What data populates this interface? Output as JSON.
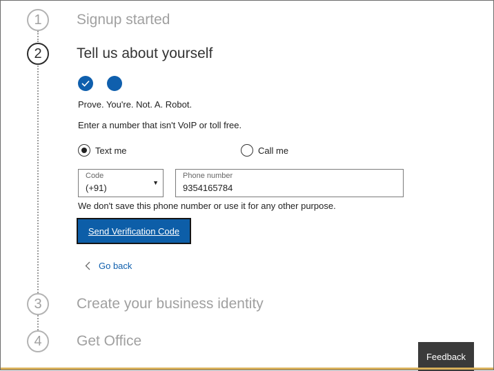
{
  "steps": [
    {
      "number": "1",
      "title": "Signup started",
      "state": "done"
    },
    {
      "number": "2",
      "title": "Tell us about yourself",
      "state": "active"
    },
    {
      "number": "3",
      "title": "Create your business identity",
      "state": "pending"
    },
    {
      "number": "4",
      "title": "Get Office",
      "state": "pending"
    }
  ],
  "progress_dots": [
    {
      "state": "complete",
      "icon": "check-icon"
    },
    {
      "state": "current",
      "icon": "none"
    }
  ],
  "prove": {
    "heading": "Prove. You're. Not. A. Robot.",
    "instruction": "Enter a number that isn't VoIP or toll free."
  },
  "contact_method": {
    "options": [
      {
        "label": "Text me",
        "selected": true
      },
      {
        "label": "Call me",
        "selected": false
      }
    ]
  },
  "code_field": {
    "label": "Code",
    "value": "(+91)"
  },
  "phone_field": {
    "label": "Phone number",
    "value": "9354165784"
  },
  "privacy_note": "We don't save this phone number or use it for any other purpose.",
  "send_button": {
    "label": "Send Verification Code"
  },
  "go_back": {
    "label": "Go back",
    "icon": "chevron-left-icon"
  },
  "feedback": {
    "label": "Feedback"
  },
  "colors": {
    "accent": "#0f5fad",
    "muted": "#a0a0a0",
    "feedback_bg": "#3a3a3a"
  }
}
